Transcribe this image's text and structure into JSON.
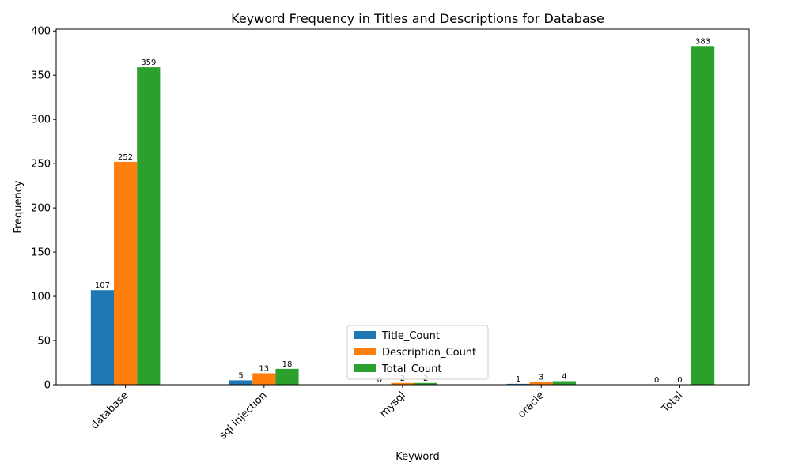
{
  "chart_data": {
    "type": "bar",
    "title": "Keyword Frequency in Titles and Descriptions for Database",
    "xlabel": "Keyword",
    "ylabel": "Frequency",
    "categories": [
      "database",
      "sql injection",
      "mysql",
      "oracle",
      "Total"
    ],
    "series": [
      {
        "name": "Title_Count",
        "color": "#1f77b4",
        "values": [
          107,
          5,
          0,
          1,
          0
        ],
        "labels": [
          "107",
          "5",
          "0",
          "1",
          "0"
        ]
      },
      {
        "name": "Description_Count",
        "color": "#ff7f0e",
        "values": [
          252,
          13,
          2,
          3,
          0
        ],
        "labels": [
          "252",
          "13",
          "2",
          "3",
          "0"
        ]
      },
      {
        "name": "Total_Count",
        "color": "#2ca02c",
        "values": [
          359,
          18,
          2,
          4,
          383
        ],
        "labels": [
          "359",
          "18",
          "2",
          "4",
          "383"
        ]
      }
    ],
    "yticks": [
      0,
      50,
      100,
      150,
      200,
      250,
      300,
      350,
      400
    ],
    "ylim": [
      0,
      402
    ],
    "grid": false,
    "legend_position": "lower-center"
  }
}
